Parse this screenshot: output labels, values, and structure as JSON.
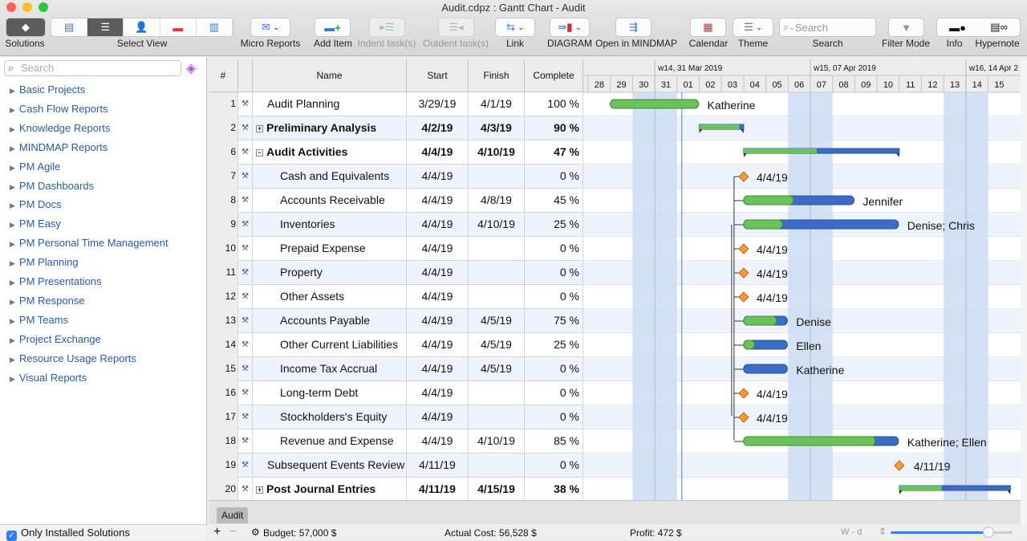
{
  "window": {
    "title": "Audit.cdpz : Gantt Chart - Audit"
  },
  "toolbar": {
    "solutions": "Solutions",
    "select_view": "Select View",
    "micro_reports": "Micro Reports",
    "add_item": "Add Item",
    "indent": "Indent task(s)",
    "outdent": "Outdent task(s)",
    "link": "Link",
    "diagram": "DIAGRAM",
    "open_mindmap": "Open in MINDMAP",
    "calendar": "Calendar",
    "theme": "Theme",
    "search_placeholder": "Search",
    "search": "Search",
    "filter_mode": "Filter Mode",
    "info": "Info",
    "hypernote": "Hypernote"
  },
  "sidebar": {
    "search_placeholder": "Search",
    "items": [
      "Basic Projects",
      "Cash Flow Reports",
      "Knowledge Reports",
      "MINDMAP Reports",
      "PM Agile",
      "PM Dashboards",
      "PM Docs",
      "PM Easy",
      "PM Personal Time Management",
      "PM Planning",
      "PM Presentations",
      "PM Response",
      "PM Teams",
      "Project Exchange",
      "Resource Usage Reports",
      "Visual Reports"
    ],
    "only_installed": "Only Installed Solutions",
    "only_installed_checked": true
  },
  "table": {
    "headers": {
      "num": "#",
      "name": "Name",
      "start": "Start",
      "finish": "Finish",
      "complete": "Complete"
    },
    "rows": [
      {
        "num": "1",
        "name": "Audit Planning",
        "start": "3/29/19",
        "finish": "4/1/19",
        "complete": "100 %",
        "type": "task",
        "level": 0,
        "resource": "Katherine",
        "s": "2019-03-29",
        "f": "2019-04-01",
        "pct": 100
      },
      {
        "num": "2",
        "name": "Preliminary Analysis",
        "start": "4/2/19",
        "finish": "4/3/19",
        "complete": "90 %",
        "type": "summary",
        "collapsed": true,
        "level": 0,
        "s": "2019-04-02",
        "f": "2019-04-03",
        "pct": 90
      },
      {
        "num": "6",
        "name": "Audit Activities",
        "start": "4/4/19",
        "finish": "4/10/19",
        "complete": "47 %",
        "type": "summary",
        "collapsed": false,
        "level": 0,
        "s": "2019-04-04",
        "f": "2019-04-10",
        "pct": 47
      },
      {
        "num": "7",
        "name": "Cash and Equivalents",
        "start": "4/4/19",
        "finish": "",
        "complete": "0 %",
        "type": "milestone",
        "level": 1,
        "label": "4/4/19",
        "s": "2019-04-04"
      },
      {
        "num": "8",
        "name": "Accounts Receivable",
        "start": "4/4/19",
        "finish": "4/8/19",
        "complete": "45 %",
        "type": "task",
        "level": 1,
        "resource": "Jennifer",
        "s": "2019-04-04",
        "f": "2019-04-08",
        "pct": 45
      },
      {
        "num": "9",
        "name": "Inventories",
        "start": "4/4/19",
        "finish": "4/10/19",
        "complete": "25 %",
        "type": "task",
        "level": 1,
        "resource": "Denise; Chris",
        "s": "2019-04-04",
        "f": "2019-04-10",
        "pct": 25
      },
      {
        "num": "10",
        "name": "Prepaid Expense",
        "start": "4/4/19",
        "finish": "",
        "complete": "0 %",
        "type": "milestone",
        "level": 1,
        "label": "4/4/19",
        "s": "2019-04-04"
      },
      {
        "num": "11",
        "name": "Property",
        "start": "4/4/19",
        "finish": "",
        "complete": "0 %",
        "type": "milestone",
        "level": 1,
        "label": "4/4/19",
        "s": "2019-04-04"
      },
      {
        "num": "12",
        "name": "Other Assets",
        "start": "4/4/19",
        "finish": "",
        "complete": "0 %",
        "type": "milestone",
        "level": 1,
        "label": "4/4/19",
        "s": "2019-04-04"
      },
      {
        "num": "13",
        "name": "Accounts Payable",
        "start": "4/4/19",
        "finish": "4/5/19",
        "complete": "75 %",
        "type": "task",
        "level": 1,
        "resource": "Denise",
        "s": "2019-04-04",
        "f": "2019-04-05",
        "pct": 75
      },
      {
        "num": "14",
        "name": "Other Current Liabilities",
        "start": "4/4/19",
        "finish": "4/5/19",
        "complete": "25 %",
        "type": "task",
        "level": 1,
        "resource": "Ellen",
        "s": "2019-04-04",
        "f": "2019-04-05",
        "pct": 25
      },
      {
        "num": "15",
        "name": "Income Tax  Accrual",
        "start": "4/4/19",
        "finish": "4/5/19",
        "complete": "0 %",
        "type": "task",
        "level": 1,
        "resource": "Katherine",
        "s": "2019-04-04",
        "f": "2019-04-05",
        "pct": 0
      },
      {
        "num": "16",
        "name": "Long-term Debt",
        "start": "4/4/19",
        "finish": "",
        "complete": "0 %",
        "type": "milestone",
        "level": 1,
        "label": "4/4/19",
        "s": "2019-04-04"
      },
      {
        "num": "17",
        "name": "Stockholders's Equity",
        "start": "4/4/19",
        "finish": "",
        "complete": "0 %",
        "type": "milestone",
        "level": 1,
        "label": "4/4/19",
        "s": "2019-04-04"
      },
      {
        "num": "18",
        "name": "Revenue and Expense",
        "start": "4/4/19",
        "finish": "4/10/19",
        "complete": "85 %",
        "type": "task",
        "level": 1,
        "resource": "Katherine; Ellen",
        "s": "2019-04-04",
        "f": "2019-04-10",
        "pct": 85
      },
      {
        "num": "19",
        "name": "Subsequent Events Review",
        "start": "4/11/19",
        "finish": "",
        "complete": "0 %",
        "type": "milestone",
        "level": 0,
        "label": "4/11/19",
        "s": "2019-04-11"
      },
      {
        "num": "20",
        "name": "Post Journal Entries",
        "start": "4/11/19",
        "finish": "4/15/19",
        "complete": "38 %",
        "type": "summary",
        "collapsed": true,
        "level": 0,
        "s": "2019-04-11",
        "f": "2019-04-15",
        "pct": 38
      }
    ]
  },
  "timeline": {
    "weeks": [
      "w14, 31 Mar 2019",
      "w15, 07 Apr 2019",
      "w16, 14 Apr 2"
    ],
    "days": [
      "28",
      "29",
      "30",
      "31",
      "01",
      "02",
      "03",
      "04",
      "05",
      "06",
      "07",
      "08",
      "09",
      "10",
      "11",
      "12",
      "13",
      "14",
      "15"
    ],
    "weekend_days": [
      "30",
      "31",
      "06",
      "07",
      "13",
      "14"
    ],
    "today": "2019-04-01"
  },
  "colors": {
    "done": "#6cc25a",
    "remaining": "#3d6cc6",
    "milestone": "#f39a34",
    "weekend": "#cddcf2",
    "today_line": "#3b82f6",
    "link": "#2563eb"
  },
  "bottom": {
    "tab": "Audit",
    "budget": "Budget: 57,000 $",
    "actual_cost": "Actual Cost: 56,528 $",
    "profit": "Profit: 472 $",
    "scale": "W - d",
    "zoom_level": 0.8
  }
}
